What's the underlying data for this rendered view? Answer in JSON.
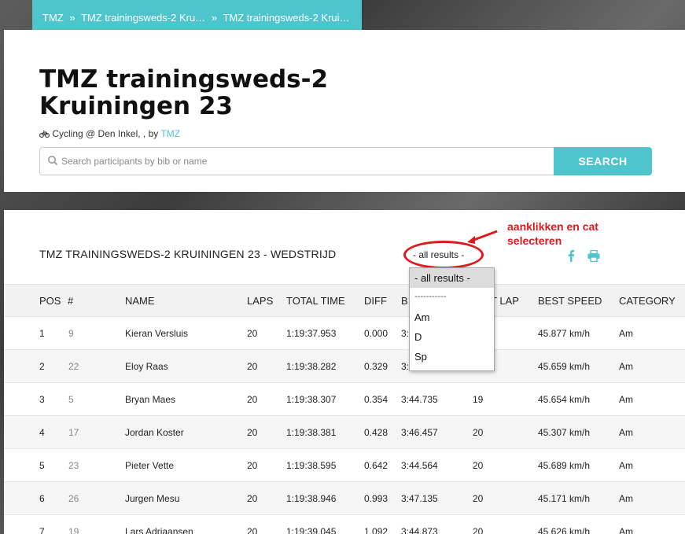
{
  "breadcrumb": {
    "items": [
      "TMZ",
      "TMZ trainingsweds-2 Kru…",
      "TMZ trainingsweds-2 Krui…"
    ],
    "separator": "»"
  },
  "header": {
    "title_line1": "TMZ trainingsweds-2",
    "title_line2": "Kruiningen 23",
    "subtitle_prefix": "Cycling @ Den Inkel, , by",
    "subtitle_link": "TMZ"
  },
  "search": {
    "placeholder": "Search participants by bib or name",
    "value": "",
    "button_label": "SEARCH"
  },
  "results": {
    "race_title": "TMZ TRAININGSWEDS-2 KRUININGEN 23 - WEDSTRIJD",
    "filter_selected": "- all results -",
    "annotation": [
      "aanklikken en cat",
      "selecteren"
    ],
    "columns": [
      "POS",
      "#",
      "NAME",
      "LAPS",
      "TOTAL TIME",
      "DIFF",
      "B",
      "T LAP",
      "BEST SPEED",
      "CATEGORY"
    ],
    "rows": [
      {
        "pos": "1",
        "bib": "9",
        "name": "Kieran Versluis",
        "laps": "20",
        "total": "1:19:37.953",
        "diff": "0.000",
        "best_lap": "3:",
        "best_lap_no": "",
        "speed": "45.877 km/h",
        "cat": "Am"
      },
      {
        "pos": "2",
        "bib": "22",
        "name": "Eloy Raas",
        "laps": "20",
        "total": "1:19:38.282",
        "diff": "0.329",
        "best_lap": "3:",
        "best_lap_no": "",
        "speed": "45.659 km/h",
        "cat": "Am"
      },
      {
        "pos": "3",
        "bib": "5",
        "name": "Bryan Maes",
        "laps": "20",
        "total": "1:19:38.307",
        "diff": "0.354",
        "best_lap": "3:44.735",
        "best_lap_no": "19",
        "speed": "45.654 km/h",
        "cat": "Am"
      },
      {
        "pos": "4",
        "bib": "17",
        "name": "Jordan Koster",
        "laps": "20",
        "total": "1:19:38.381",
        "diff": "0.428",
        "best_lap": "3:46.457",
        "best_lap_no": "20",
        "speed": "45.307 km/h",
        "cat": "Am"
      },
      {
        "pos": "5",
        "bib": "23",
        "name": "Pieter Vette",
        "laps": "20",
        "total": "1:19:38.595",
        "diff": "0.642",
        "best_lap": "3:44.564",
        "best_lap_no": "20",
        "speed": "45.689 km/h",
        "cat": "Am"
      },
      {
        "pos": "6",
        "bib": "26",
        "name": "Jurgen Mesu",
        "laps": "20",
        "total": "1:19:38.946",
        "diff": "0.993",
        "best_lap": "3:47.135",
        "best_lap_no": "20",
        "speed": "45.171 km/h",
        "cat": "Am"
      },
      {
        "pos": "7",
        "bib": "19",
        "name": "Lars Adriaansen",
        "laps": "20",
        "total": "1:19:39.045",
        "diff": "1.092",
        "best_lap": "3:44.873",
        "best_lap_no": "20",
        "speed": "45.626 km/h",
        "cat": "Am"
      }
    ]
  },
  "dropdown": {
    "options": [
      "- all results -",
      "-----------",
      "Am",
      "D",
      "Sp"
    ]
  },
  "colors": {
    "accent": "#4ec5cc",
    "annotation": "#e0181b"
  }
}
